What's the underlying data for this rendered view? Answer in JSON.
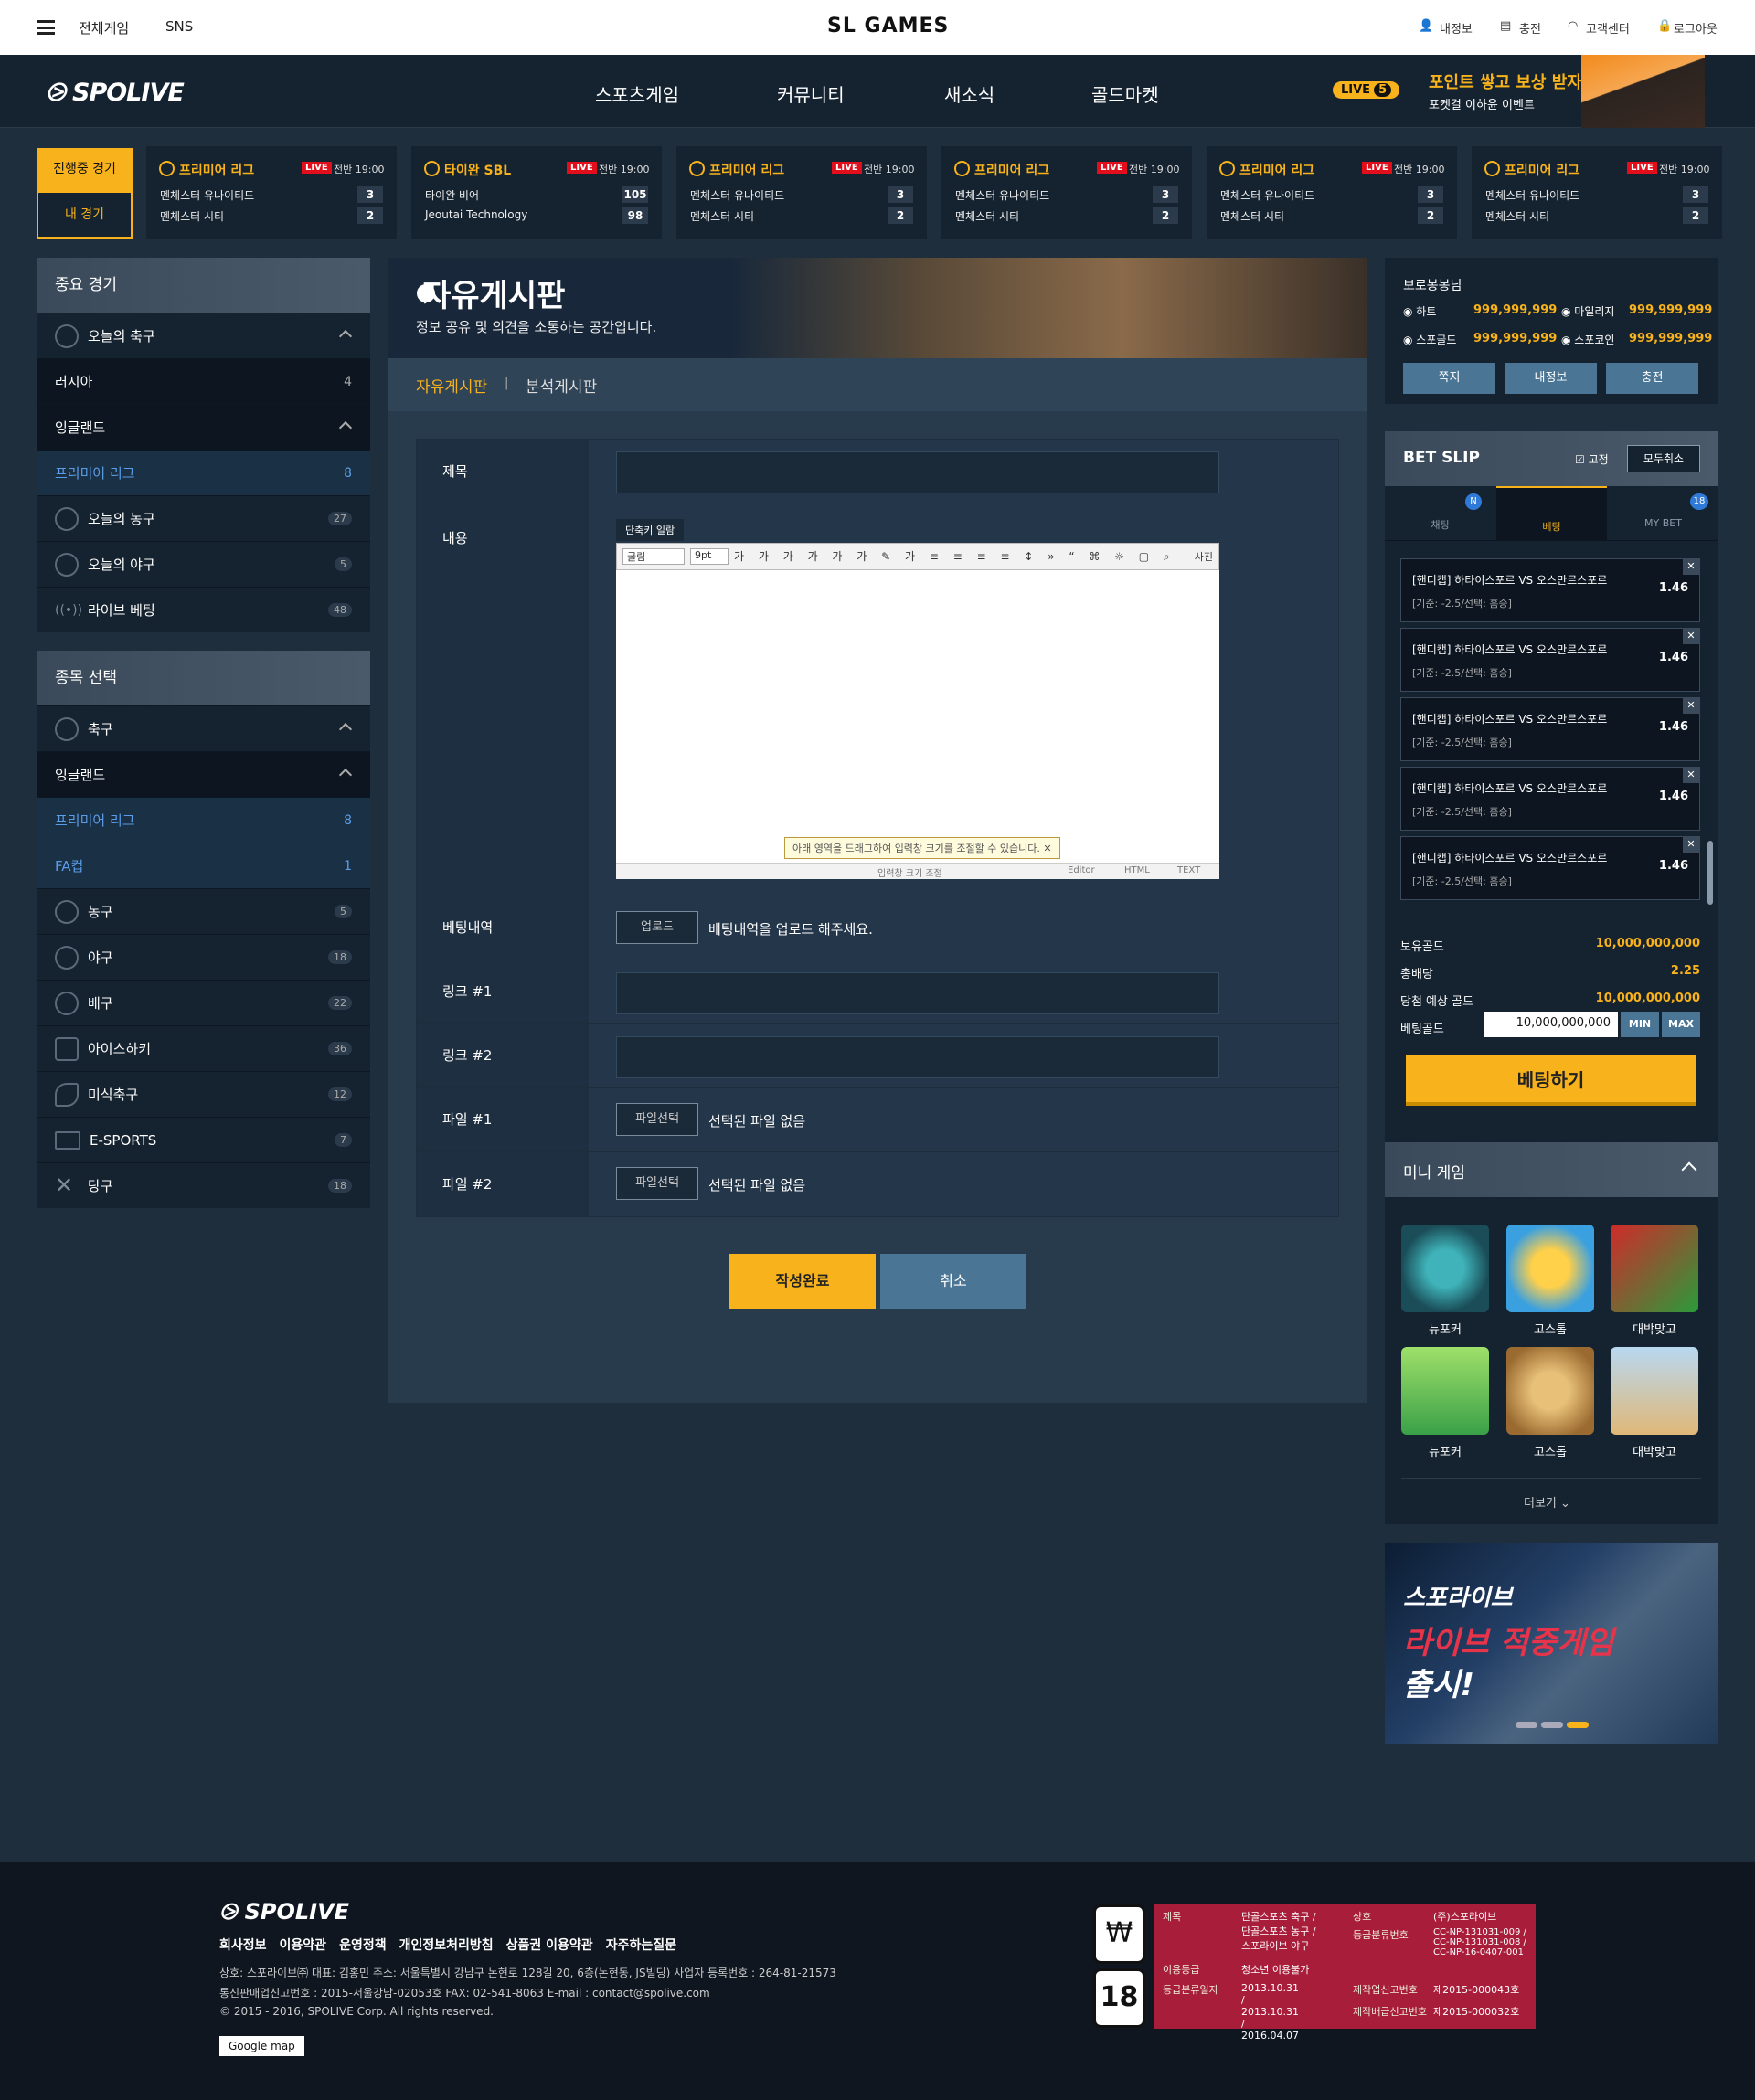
{
  "topbar": {
    "all_games": "전체게임",
    "sns": "SNS",
    "site_title": "SL GAMES",
    "my_info": "내정보",
    "charge": "충전",
    "support": "고객센터",
    "logout": "로그아웃"
  },
  "nav": {
    "logo": "SPOLIVE",
    "items": [
      "스포츠게임",
      "커뮤니티",
      "새소식",
      "골드마켓"
    ],
    "live_label": "LIVE",
    "live_count": "5",
    "promo_title": "포인트 쌓고 보상 받자!",
    "promo_sub": "포켓걸 이하윤 이벤트"
  },
  "live_tabs": {
    "in_progress": "진행중 경기",
    "mine": "내 경기"
  },
  "live_cards": [
    {
      "league": "프리미어 리그",
      "live": "LIVE",
      "time": "전반 19:00",
      "team1": "멘체스터 유나이티드",
      "team2": "멘체스터 시티",
      "score1": "3",
      "score2": "2"
    },
    {
      "league": "타이완 SBL",
      "live": "LIVE",
      "time": "전반 19:00",
      "team1": "타이완 비어",
      "team2": "Jeoutai Technology",
      "score1": "105",
      "score2": "98"
    },
    {
      "league": "프리미어 리그",
      "live": "LIVE",
      "time": "전반 19:00",
      "team1": "멘체스터 유나이티드",
      "team2": "멘체스터 시티",
      "score1": "3",
      "score2": "2"
    },
    {
      "league": "프리미어 리그",
      "live": "LIVE",
      "time": "전반 19:00",
      "team1": "멘체스터 유나이티드",
      "team2": "멘체스터 시티",
      "score1": "3",
      "score2": "2"
    },
    {
      "league": "프리미어 리그",
      "live": "LIVE",
      "time": "전반 19:00",
      "team1": "멘체스터 유나이티드",
      "team2": "멘체스터 시티",
      "score1": "3",
      "score2": "2"
    },
    {
      "league": "프리미어 리그",
      "live": "LIVE",
      "time": "전반 19:00",
      "team1": "멘체스터 유나이티드",
      "team2": "멘체스터 시티",
      "score1": "3",
      "score2": "2"
    }
  ],
  "important": {
    "title": "중요 경기",
    "rows": [
      {
        "label": "오늘의 축구",
        "count": ""
      },
      {
        "label": "러시아",
        "count": "4"
      },
      {
        "label": "잉글랜드",
        "count": ""
      },
      {
        "label": "프리미어 리그",
        "count": "8"
      },
      {
        "label": "오늘의 농구",
        "count": "27"
      },
      {
        "label": "오늘의 야구",
        "count": "5"
      },
      {
        "label": "라이브 베팅",
        "count": "48"
      }
    ]
  },
  "sports": {
    "title": "종목 선택",
    "rows": [
      {
        "label": "축구",
        "count": ""
      },
      {
        "label": "잉글랜드",
        "count": ""
      },
      {
        "label": "프리미어 리그",
        "count": "8"
      },
      {
        "label": "FA컵",
        "count": "1"
      },
      {
        "label": "농구",
        "count": "5"
      },
      {
        "label": "야구",
        "count": "18"
      },
      {
        "label": "배구",
        "count": "22"
      },
      {
        "label": "아이스하키",
        "count": "36"
      },
      {
        "label": "미식축구",
        "count": "12"
      },
      {
        "label": "E-SPORTS",
        "count": "7"
      },
      {
        "label": "당구",
        "count": "18"
      }
    ]
  },
  "board": {
    "title": "자유게시판",
    "subtitle": "정보 공유 및 의견을 소통하는 공간입니다.",
    "tab_free": "자유게시판",
    "tab_sep": "|",
    "tab_analysis": "분석게시판"
  },
  "form": {
    "title_label": "제목",
    "content_label": "내용",
    "editor_tag": "단축키 일람",
    "editor_font": "굴림",
    "editor_size": "9pt",
    "editor_photo": "사진",
    "editor_hint": "아래 영역을 드래그하여 입력창 크기를 조절할 수 있습니다.",
    "editor_resize": "입력창 크기 조절",
    "editor_modes": [
      "Editor",
      "HTML",
      "TEXT"
    ],
    "betting_label": "베팅내역",
    "upload_btn": "업로드",
    "upload_text": "베팅내역을 업로드 해주세요.",
    "link1_label": "링크 #1",
    "link2_label": "링크 #2",
    "file1_label": "파일 #1",
    "file2_label": "파일 #2",
    "file_btn": "파일선택",
    "file_none": "선택된 파일 없음",
    "submit": "작성완료",
    "cancel": "취소"
  },
  "user": {
    "name": "보로봉봉님",
    "heart_label": "하트",
    "heart_val": "999,999,999",
    "mileage_label": "마일리지",
    "mileage_val": "999,999,999",
    "sgold_label": "스포골드",
    "sgold_val": "999,999,999",
    "scoin_label": "스포코인",
    "scoin_val": "999,999,999",
    "btn_note": "쪽지",
    "btn_info": "내정보",
    "btn_charge": "충전"
  },
  "betslip": {
    "title": "BET SLIP",
    "fixed": "고정",
    "clear": "모두취소",
    "tabs": [
      {
        "label": "채팅",
        "badge": "N"
      },
      {
        "label": "베팅",
        "badge": ""
      },
      {
        "label": "MY BET",
        "badge": "18"
      }
    ],
    "items": [
      {
        "match": "[핸디캡] 하타이스포르 VS 오스만르스포르",
        "detail": "[기준: -2.5/선택: 홈승]",
        "odds": "1.46"
      },
      {
        "match": "[핸디캡] 하타이스포르 VS 오스만르스포르",
        "detail": "[기준: -2.5/선택: 홈승]",
        "odds": "1.46"
      },
      {
        "match": "[핸디캡] 하타이스포르 VS 오스만르스포르",
        "detail": "[기준: -2.5/선택: 홈승]",
        "odds": "1.46"
      },
      {
        "match": "[핸디캡] 하타이스포르 VS 오스만르스포르",
        "detail": "[기준: -2.5/선택: 홈승]",
        "odds": "1.46"
      },
      {
        "match": "[핸디캡] 하타이스포르 VS 오스만르스포르",
        "detail": "[기준: -2.5/선택: 홈승]",
        "odds": "1.46"
      }
    ],
    "hold_label": "보유골드",
    "hold_val": "10,000,000,000",
    "total_label": "총배당",
    "total_val": "2.25",
    "expect_label": "당첨 예상 골드",
    "expect_val": "10,000,000,000",
    "bet_label": "베팅골드",
    "bet_val": "10,000,000,000",
    "min": "MIN",
    "max": "MAX",
    "bet_btn": "베팅하기"
  },
  "mini": {
    "title": "미니 게임",
    "games": [
      "뉴포커",
      "고스톱",
      "대박맞고",
      "뉴포커",
      "고스톱",
      "대박맞고"
    ],
    "more": "더보기"
  },
  "banner": {
    "line1": "스포라이브",
    "line2": "라이브 적중게임",
    "line3": "출시!"
  },
  "footer": {
    "logo": "SPOLIVE",
    "links": [
      "회사정보",
      "이용약관",
      "운영정책",
      "개인정보처리방침",
      "상품권 이용약관",
      "자주하는질문"
    ],
    "info1": "상호: 스포라이브㈜   대표: 김홍민   주소: 서울특별시 강남구 논현로 128길 20, 6층(논현동, JS빌딩)   사업자 등록번호 : 264-81-21573",
    "info2": "통신판매업신고번호 : 2015-서울강남-02053호   FAX: 02-541-8063   E-mail : contact@spolive.com",
    "info3": "© 2015 - 2016, SPOLIVE Corp. All rights reserved.",
    "gmap": "Google map",
    "rating": {
      "title_label": "제목",
      "title_val": "단골스포츠 축구 / 단골스포츠 농구 / 스포라이브 야구",
      "grade_label": "이용등급",
      "grade_val": "청소년 이용불가",
      "date_label": "등급분류일자",
      "date_val": "2013.10.31 / 2013.10.31 / 2016.04.07",
      "company_label": "상호",
      "company_val": "(주)스포라이브",
      "no_label": "등급분류번호",
      "no_val": "CC-NP-131031-009 / CC-NP-131031-008 / CC-NP-16-0407-001",
      "make_label": "제작업신고번호",
      "make_val": "제2015-000043호",
      "dist_label": "제작배급신고번호",
      "dist_val": "제2015-000032호"
    }
  }
}
